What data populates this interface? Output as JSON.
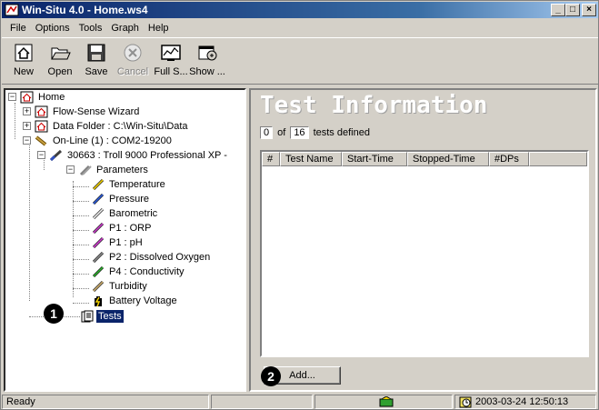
{
  "window": {
    "title": "Win-Situ 4.0 - Home.ws4",
    "min_btn": "_",
    "max_btn": "□",
    "close_btn": "×"
  },
  "menu": [
    "File",
    "Options",
    "Tools",
    "Graph",
    "Help"
  ],
  "toolbar": {
    "new": "New",
    "open": "Open",
    "save": "Save",
    "cancel": "Cancel",
    "full": "Full S...",
    "show": "Show ..."
  },
  "tree": {
    "home": "Home",
    "flow_sense": "Flow-Sense Wizard",
    "data_folder": "Data Folder : C:\\Win-Situ\\Data",
    "online": "On-Line (1) : COM2-19200",
    "device": "30663 : Troll 9000 Professional XP -",
    "parameters": "Parameters",
    "params": [
      "Temperature",
      "Pressure",
      "Barometric",
      "P1 : ORP",
      "P1 : pH",
      "P2 : Dissolved Oxygen",
      "P4 : Conductivity",
      "Turbidity",
      "Battery Voltage"
    ],
    "tests": "Tests",
    "expand_plus": "+",
    "expand_minus": "−"
  },
  "callouts": {
    "one": "1",
    "two": "2"
  },
  "test_info": {
    "title": "Test Information",
    "count": "0",
    "of": "of",
    "total": "16",
    "suffix": "tests defined",
    "columns": [
      "#",
      "Test Name",
      "Start-Time",
      "Stopped-Time",
      "#DPs",
      ""
    ],
    "add_button": "Add..."
  },
  "status": {
    "text": "Ready",
    "datetime": "2003-03-24  12:50:13"
  },
  "colors": {
    "titlebar": "#0a246a",
    "face": "#d4d0c8",
    "selection": "#0a246a"
  }
}
